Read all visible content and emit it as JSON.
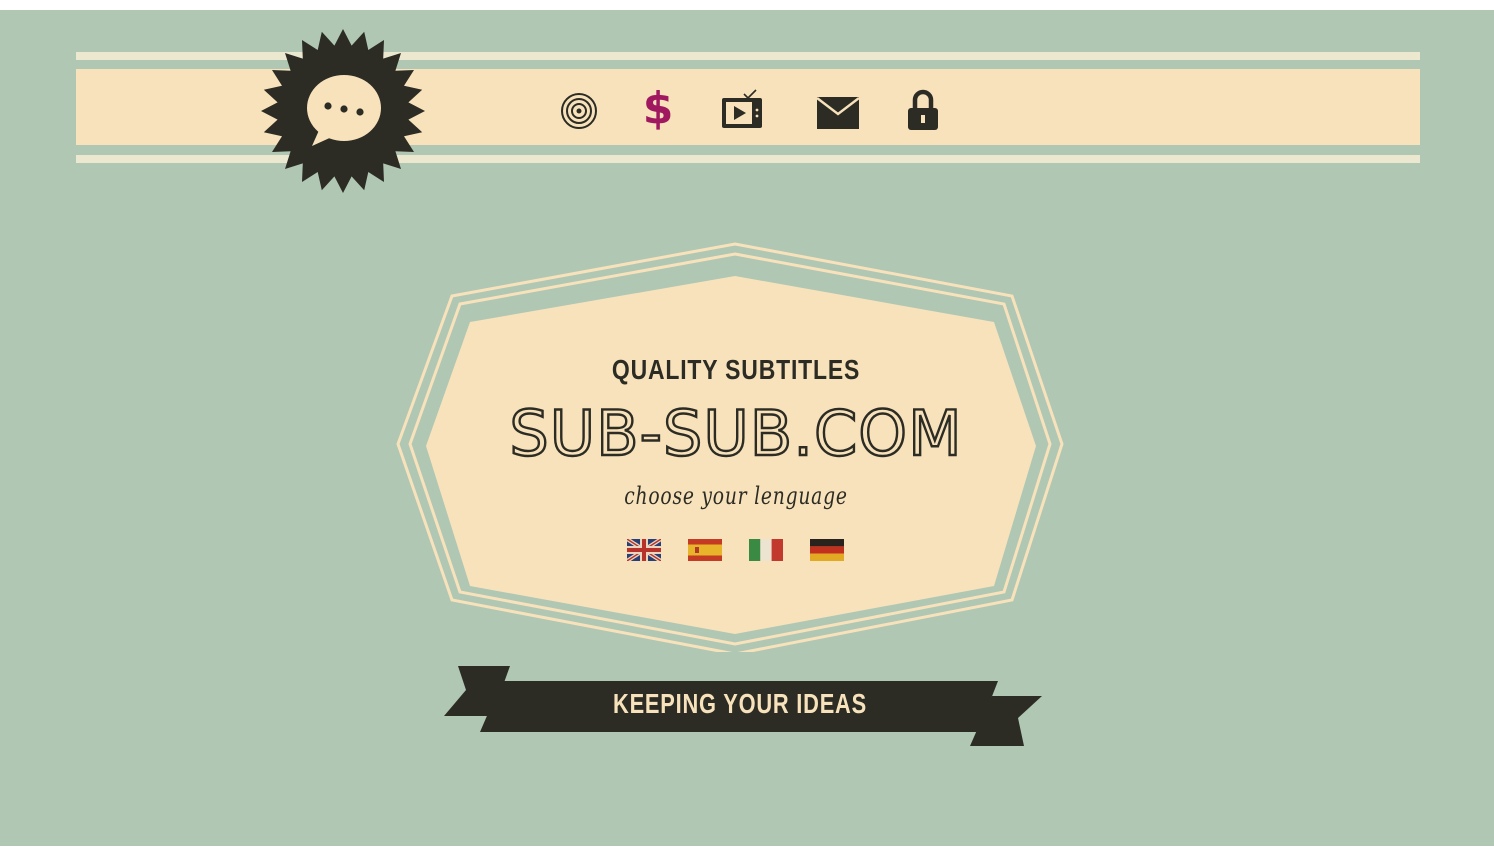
{
  "header": {
    "logo_icon": "speech-bubble-ellipsis-icon",
    "nav": [
      {
        "name": "target-icon"
      },
      {
        "name": "dollar-icon",
        "glyph": "$",
        "color": "#a01860"
      },
      {
        "name": "tv-play-icon"
      },
      {
        "name": "mail-icon"
      },
      {
        "name": "lock-icon"
      }
    ]
  },
  "main": {
    "tagline": "QUALITY SUBTITLES",
    "site_name": "SUB-SUB.COM",
    "choose_language": "choose your lenguage",
    "languages": [
      {
        "flag": "uk-flag-icon"
      },
      {
        "flag": "spain-flag-icon"
      },
      {
        "flag": "italy-flag-icon"
      },
      {
        "flag": "germany-flag-icon"
      }
    ]
  },
  "ribbon": {
    "text": "KEEPING YOUR IDEAS"
  },
  "colors": {
    "background": "#afc7b3",
    "cream": "#f7e2bb",
    "dark": "#2c2c24",
    "accent": "#a01860"
  }
}
